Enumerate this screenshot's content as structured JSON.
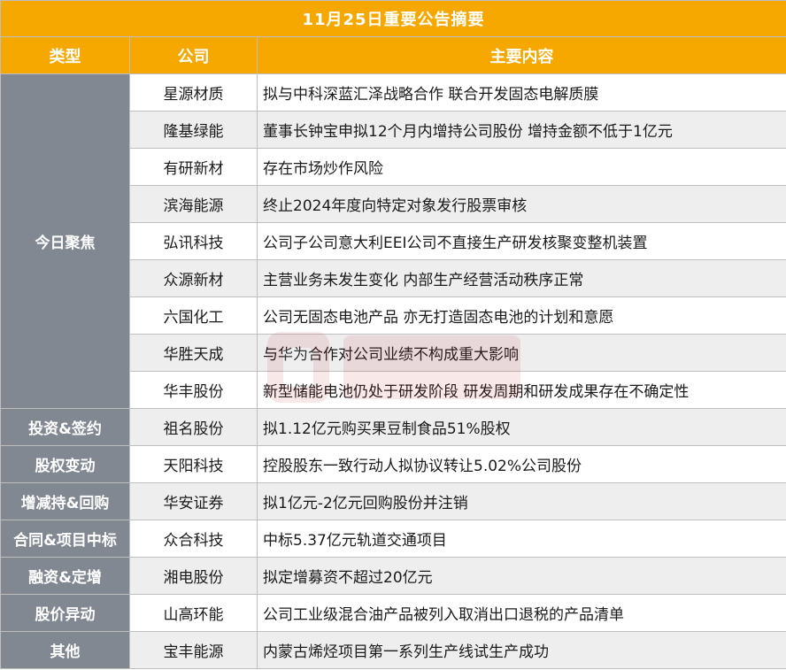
{
  "title": "11月25日重要公告摘要",
  "headers": {
    "type": "类型",
    "company": "公司",
    "content": "主要内容"
  },
  "groups": [
    {
      "category": "今日聚焦",
      "rows": [
        {
          "company": "星源材质",
          "content": "拟与中科深蓝汇泽战略合作 联合开发固态电解质膜"
        },
        {
          "company": "隆基绿能",
          "content": "董事长钟宝申拟12个月内增持公司股份 增持金额不低于1亿元"
        },
        {
          "company": "有研新材",
          "content": "存在市场炒作风险"
        },
        {
          "company": "滨海能源",
          "content": "终止2024年度向特定对象发行股票审核"
        },
        {
          "company": "弘讯科技",
          "content": "公司子公司意大利EEI公司不直接生产研发核聚变整机装置"
        },
        {
          "company": "众源新材",
          "content": "主营业务未发生变化 内部生产经营活动秩序正常"
        },
        {
          "company": "六国化工",
          "content": "公司无固态电池产品 亦无打造固态电池的计划和意愿"
        },
        {
          "company": "华胜天成",
          "content": "与华为合作对公司业绩不构成重大影响"
        },
        {
          "company": "华丰股份",
          "content": "新型储能电池仍处于研发阶段 研发周期和研发成果存在不确定性"
        }
      ]
    },
    {
      "category": "投资&签约",
      "rows": [
        {
          "company": "祖名股份",
          "content": "拟1.12亿元购买果豆制食品51%股权"
        }
      ]
    },
    {
      "category": "股权变动",
      "rows": [
        {
          "company": "天阳科技",
          "content": "控股股东一致行动人拟协议转让5.02%公司股份"
        }
      ]
    },
    {
      "category": "增减持&回购",
      "rows": [
        {
          "company": "华安证券",
          "content": "拟1亿元-2亿元回购股份并注销"
        }
      ]
    },
    {
      "category": "合同&项目中标",
      "rows": [
        {
          "company": "众合科技",
          "content": "中标5.37亿元轨道交通项目"
        }
      ]
    },
    {
      "category": "融资&定增",
      "rows": [
        {
          "company": "湘电股份",
          "content": "拟定增募资不超过20亿元"
        }
      ]
    },
    {
      "category": "股价异动",
      "rows": [
        {
          "company": "山高环能",
          "content": "公司工业级混合油产品被列入取消出口退税的产品清单"
        }
      ]
    },
    {
      "category": "其他",
      "rows": [
        {
          "company": "宝丰能源",
          "content": "内蒙古烯烃项目第一系列生产线试生产成功"
        }
      ]
    }
  ],
  "colors": {
    "header_bg": "#f6a800",
    "category_bg": "#818892",
    "alt_row_bg": "#eeeeee",
    "text": "#1a1a1a"
  },
  "watermark_icon": "cls-logo-watermark"
}
